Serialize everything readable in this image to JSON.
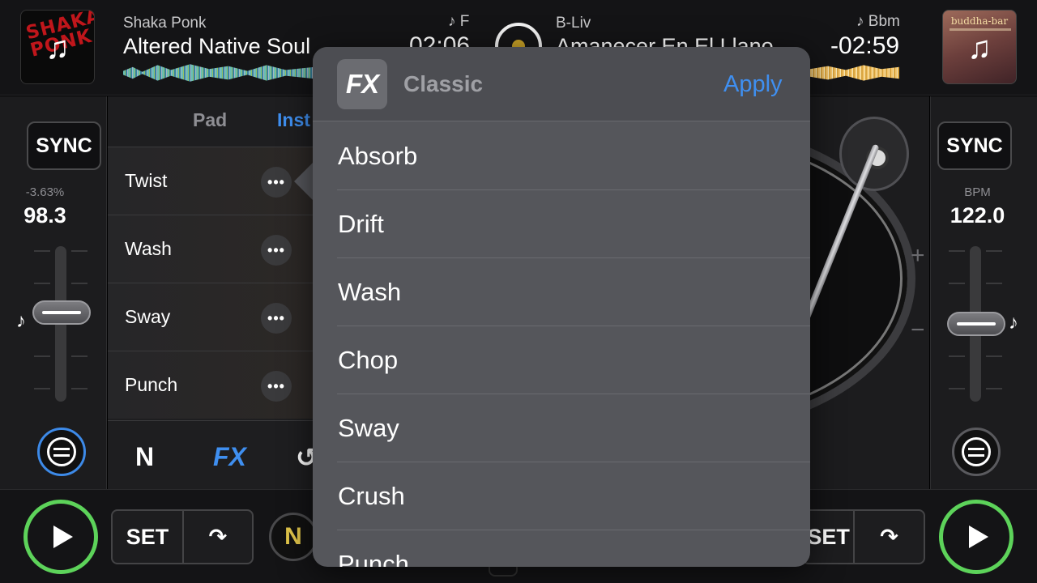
{
  "deck_left": {
    "artist": "Shaka Ponk",
    "title": "Altered Native Soul",
    "key": "♪ F",
    "time": "02:06",
    "art_label": "SHAKA PONK",
    "sync_label": "SYNC",
    "pitch_percent": "-3.63%",
    "bpm": "98.3"
  },
  "deck_right": {
    "artist": "B-Liv",
    "title": "Amanecer En El Llano",
    "key": "♪ Bbm",
    "time": "-02:59",
    "art_label": "buddha-bar",
    "sync_label": "SYNC",
    "bpm_label": "BPM",
    "bpm": "122.0"
  },
  "fx_panel": {
    "tabs": [
      "Pad",
      "Inst"
    ],
    "slots": [
      "Twist",
      "Wash",
      "Sway",
      "Punch"
    ],
    "more_label": "•••",
    "bar_labels": [
      "N",
      "FX",
      "↺"
    ]
  },
  "bottom": {
    "set_label": "SET",
    "set_label_right": "SET",
    "n_label": "N",
    "curve_glyph": "↷"
  },
  "turntable": {
    "plus": "+",
    "minus": "−"
  },
  "popover": {
    "logo": "FX",
    "title": "Classic",
    "apply_label": "Apply",
    "items": [
      "Absorb",
      "Drift",
      "Wash",
      "Chop",
      "Sway",
      "Crush",
      "Punch"
    ]
  },
  "colors": {
    "accent_blue": "#3f8ff0",
    "play_green": "#5dd35a",
    "popover_bg": "#55565b"
  }
}
